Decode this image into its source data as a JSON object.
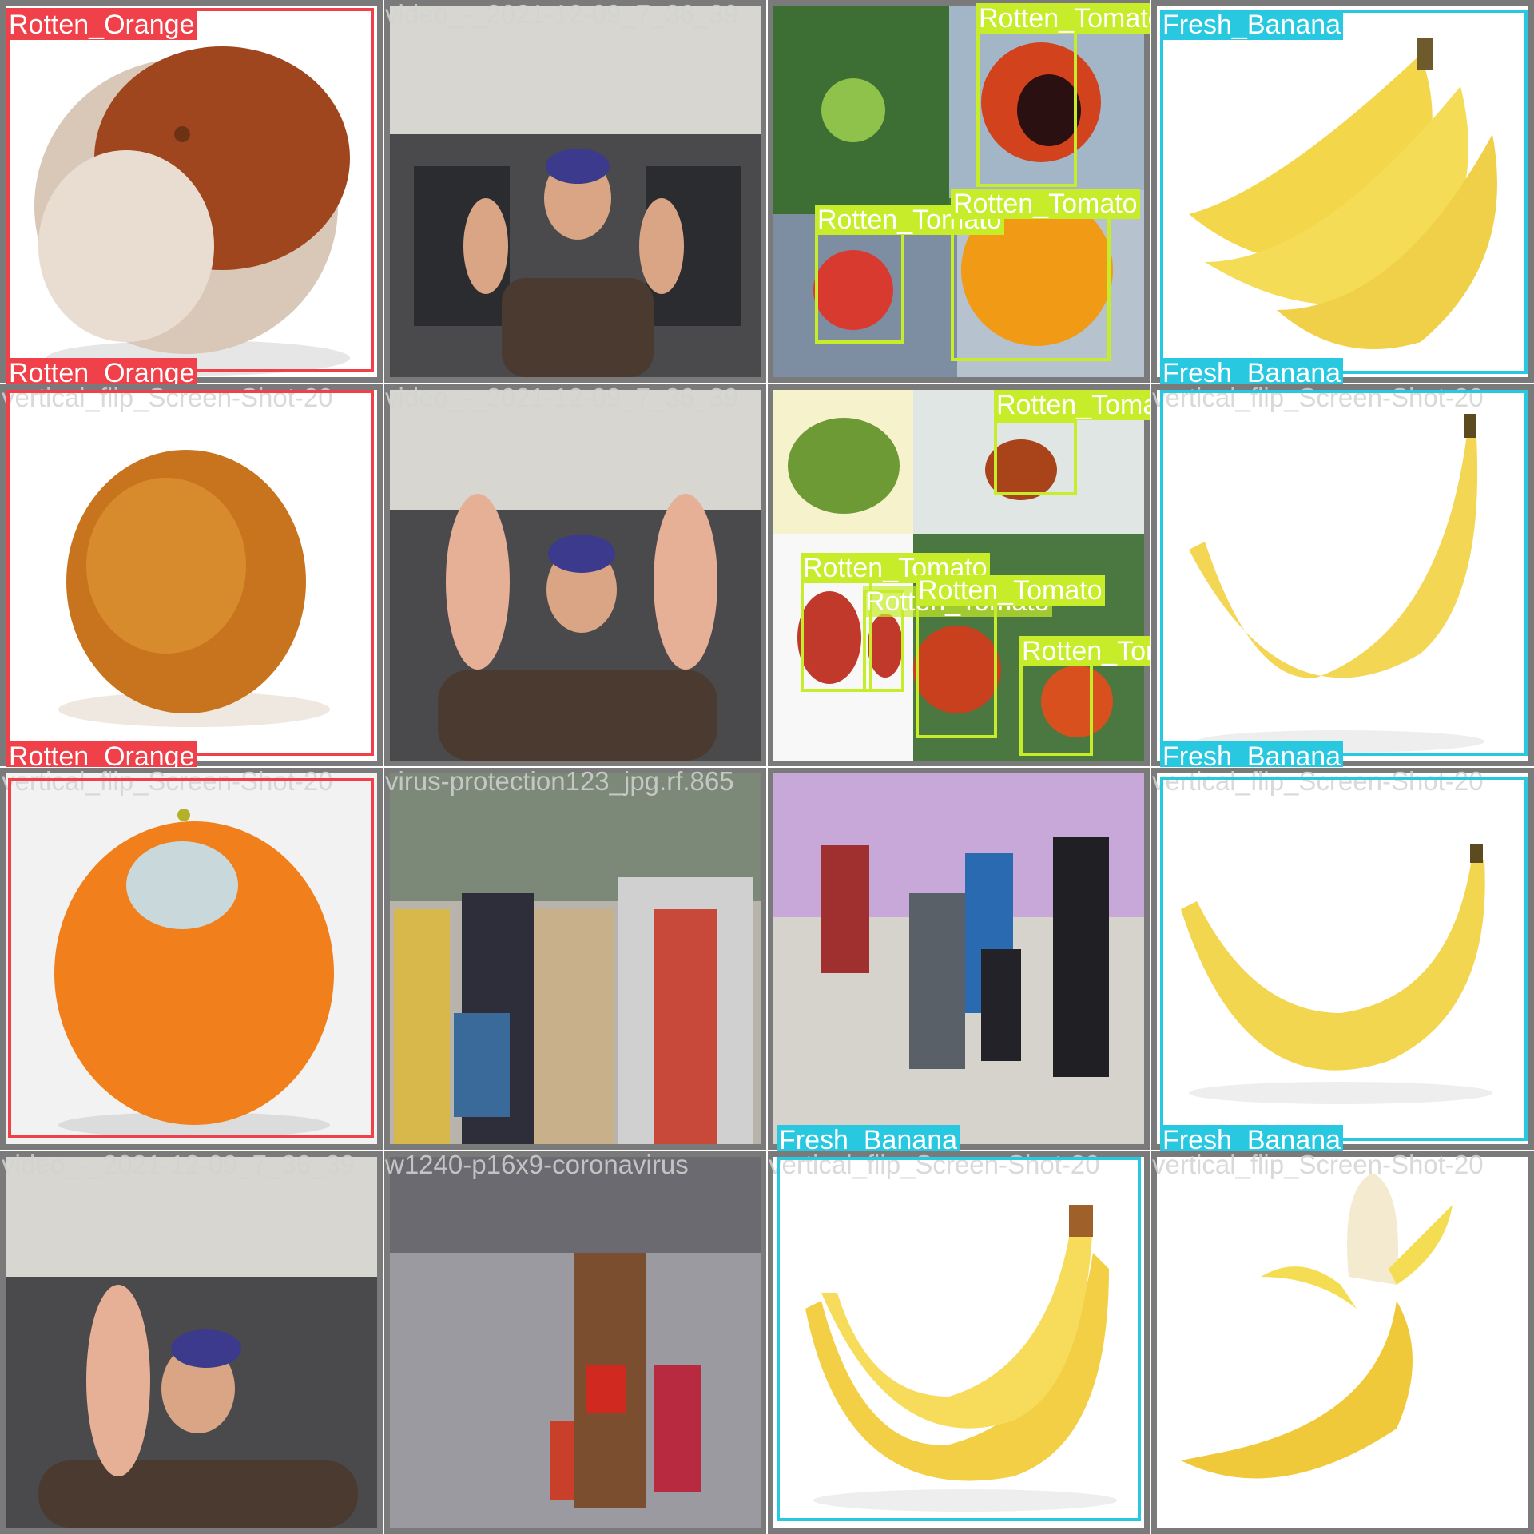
{
  "grid": {
    "cells": [
      {
        "filename": "",
        "labels": [
          "Rotten_Orange",
          "Rotten_Orange"
        ]
      },
      {
        "filename": "video_-_2021-12-09_7_36_39",
        "labels": []
      },
      {
        "filename": "",
        "labels": [
          "Rotten_Tomato",
          "Rotten_Tomato",
          "Rotten_Tomato"
        ]
      },
      {
        "filename": "",
        "labels": [
          "Fresh_Banana",
          "Fresh_Banana"
        ]
      },
      {
        "filename": "vertical_flip_Screen-Shot-20",
        "labels": []
      },
      {
        "filename": "video_-_2021-12-09_7_36_39",
        "labels": []
      },
      {
        "filename": "",
        "labels": [
          "Rotten_Tomato",
          "Rotten_Tomato",
          "Rotten_Tomato",
          "Rotten_Tomato",
          "Rotten_Tomato"
        ]
      },
      {
        "filename": "vertical_flip_Screen-Shot-20",
        "labels": [
          "Fresh_Banana"
        ]
      },
      {
        "filename": "vertical_flip_Screen-Shot-20",
        "labels": []
      },
      {
        "filename": "virus-protection123_jpg.rf.865",
        "labels": []
      },
      {
        "filename": "",
        "labels": [
          "Fresh_Banana"
        ]
      },
      {
        "filename": "vertical_flip_Screen-Shot-20",
        "labels": []
      },
      {
        "filename": "video_-_2021-12-09_7_36_39",
        "labels": []
      },
      {
        "filename": "w1240-p16x9-coronavirus",
        "labels": []
      },
      {
        "filename": "vertical_flip_Screen-Shot-20",
        "labels": []
      },
      {
        "filename": "vertical_flip_Screen-Shot-20",
        "labels": []
      }
    ]
  },
  "colors": {
    "Rotten_Orange": "#f0404a",
    "Rotten_Tomato": "#c6ec2a",
    "Fresh_Banana": "#27c8e0"
  }
}
